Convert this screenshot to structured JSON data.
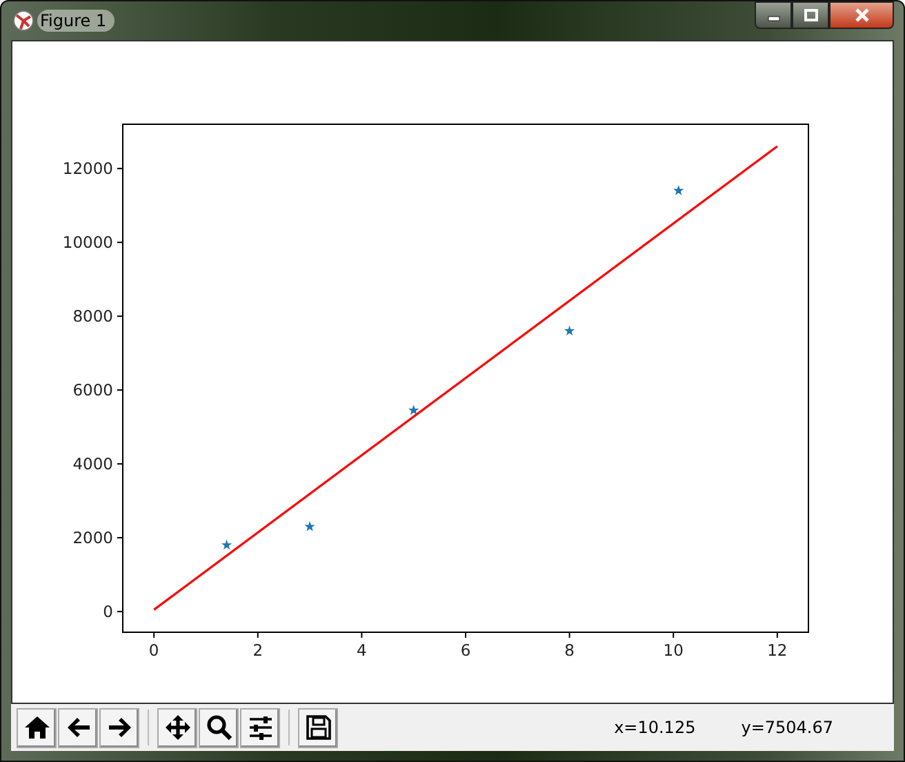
{
  "window": {
    "title": "Figure 1",
    "controls": [
      {
        "kind": "minimize"
      },
      {
        "kind": "maximize"
      },
      {
        "kind": "close"
      }
    ]
  },
  "figure": {
    "chart_data": {
      "type": "scatter",
      "xlim": [
        -0.6,
        12.6
      ],
      "ylim": [
        -560,
        13200
      ],
      "xticks": [
        0,
        2,
        4,
        6,
        8,
        10,
        12
      ],
      "yticks": [
        0,
        2000,
        4000,
        6000,
        8000,
        10000,
        12000
      ],
      "series": [
        {
          "color": "#1f77b4",
          "x": [
            1.4,
            3,
            5,
            8,
            10.1
          ],
          "values": [
            1800,
            2300,
            5450,
            7600,
            11400
          ]
        },
        {
          "type": "line",
          "color": "#ff0000",
          "x": [
            0,
            12
          ],
          "values": [
            50,
            12600
          ]
        }
      ]
    }
  },
  "toolbar": {
    "groups": [
      [
        {
          "kind": "home"
        },
        {
          "kind": "back"
        },
        {
          "kind": "forward"
        }
      ],
      [
        {
          "kind": "pan"
        },
        {
          "kind": "zoom"
        },
        {
          "kind": "configure"
        }
      ],
      [
        {
          "kind": "save"
        }
      ]
    ],
    "status": [
      "x=10.125",
      "y=7504.67"
    ]
  }
}
